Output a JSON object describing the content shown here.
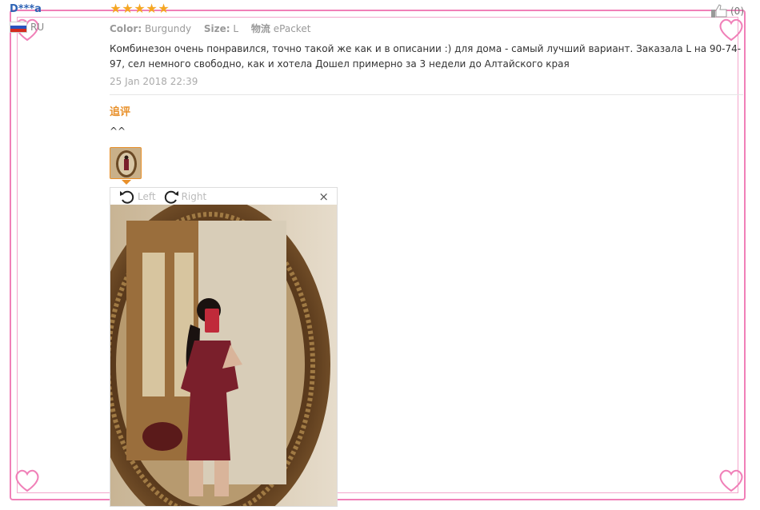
{
  "reviewer": {
    "name": "D***a",
    "country": "RU"
  },
  "review": {
    "stars": [
      "★",
      "★",
      "★",
      "★",
      "★"
    ],
    "attributes": [
      {
        "label": "Color:",
        "value": "Burgundy"
      },
      {
        "label": "Size:",
        "value": "L"
      },
      {
        "label": "物流",
        "value": "ePacket"
      }
    ],
    "text": "Комбинезон очень понравился, точно такой же как и в описании :) для дома - самый лучший вариант. Заказала L на 90-74-97, сел немного свободно, как и хотела Дошел примерно за 3 недели до Алтайского края",
    "date": "25 Jan 2018 22:39"
  },
  "followup": {
    "title": "追评",
    "text": "^^"
  },
  "viewer": {
    "rotate_left": "Left",
    "rotate_right": "Right",
    "close": "×"
  },
  "helpful": {
    "count": "(0)"
  },
  "colors": {
    "accent": "#e8902a",
    "name_blue": "#2f64b5",
    "star": "#f5a623",
    "frame_pink": "#f080b8",
    "dress": "#7a1f2b"
  }
}
